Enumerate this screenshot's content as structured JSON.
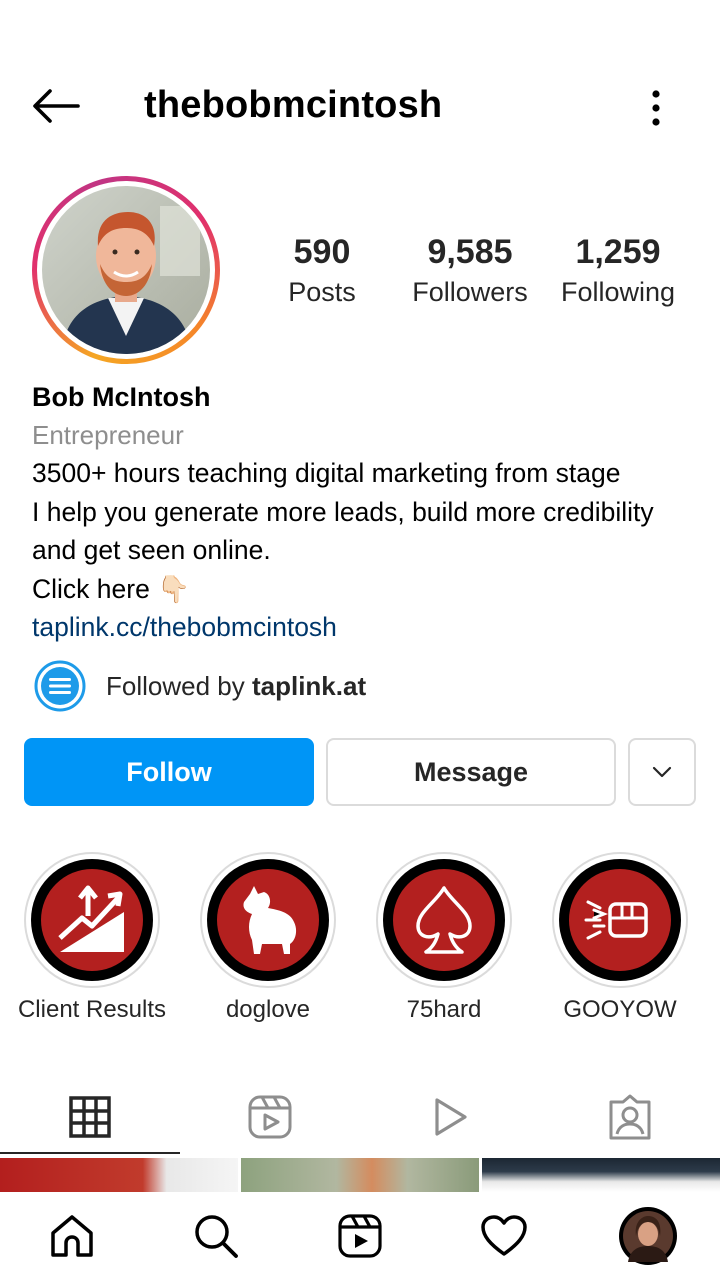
{
  "header": {
    "username": "thebobmcintosh",
    "back_icon": "arrow-left-icon",
    "more_icon": "more-vertical-icon"
  },
  "profile": {
    "avatar_icon": "profile-photo",
    "stats": [
      {
        "value": "590",
        "label": "Posts"
      },
      {
        "value": "9,585",
        "label": "Followers"
      },
      {
        "value": "1,259",
        "label": "Following"
      }
    ]
  },
  "bio": {
    "name": "Bob McIntosh",
    "category": "Entrepreneur",
    "lines": [
      "3500+ hours teaching digital marketing from stage",
      "I help you generate more leads, build more credibility",
      "and get seen online."
    ],
    "cta": "Click here",
    "cta_emoji": "👇🏻",
    "link": "taplink.cc/thebobmcintosh"
  },
  "followed_by": {
    "prefix": "Followed by",
    "account": "taplink.at"
  },
  "actions": {
    "follow": "Follow",
    "message": "Message",
    "more_icon": "chevron-down-icon"
  },
  "highlights": [
    {
      "label": "Client Results",
      "icon": "growth-chart-icon"
    },
    {
      "label": "doglove",
      "icon": "dog-icon"
    },
    {
      "label": "75hard",
      "icon": "spade-icon"
    },
    {
      "label": "GOOYOW",
      "icon": "fist-icon"
    }
  ],
  "tabs": [
    {
      "name": "grid",
      "icon": "grid-icon",
      "active": true
    },
    {
      "name": "reels",
      "icon": "reels-icon"
    },
    {
      "name": "videos",
      "icon": "play-icon"
    },
    {
      "name": "tagged",
      "icon": "tagged-icon"
    }
  ],
  "bottom_nav": [
    {
      "name": "home",
      "icon": "home-icon"
    },
    {
      "name": "search",
      "icon": "search-icon"
    },
    {
      "name": "reels",
      "icon": "reels-icon"
    },
    {
      "name": "activity",
      "icon": "heart-icon"
    },
    {
      "name": "profile",
      "icon": "avatar-icon"
    }
  ],
  "colors": {
    "follow_blue": "#0095f6",
    "link_blue": "#00376b",
    "highlight_red": "#b3201f",
    "muted_gray": "#8e8e8e"
  }
}
